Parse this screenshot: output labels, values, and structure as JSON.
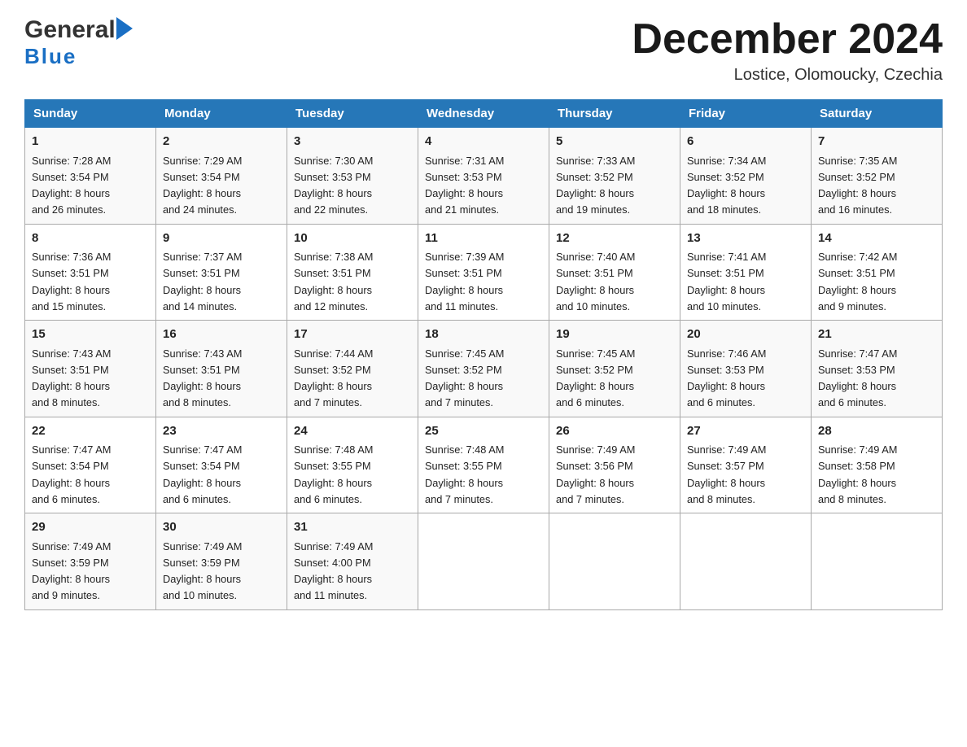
{
  "header": {
    "month_title": "December 2024",
    "location": "Lostice, Olomoucky, Czechia"
  },
  "logo": {
    "general": "General",
    "blue": "Blue"
  },
  "days_of_week": [
    "Sunday",
    "Monday",
    "Tuesday",
    "Wednesday",
    "Thursday",
    "Friday",
    "Saturday"
  ],
  "weeks": [
    [
      {
        "day": "1",
        "sunrise": "7:28 AM",
        "sunset": "3:54 PM",
        "daylight": "8 hours and 26 minutes."
      },
      {
        "day": "2",
        "sunrise": "7:29 AM",
        "sunset": "3:54 PM",
        "daylight": "8 hours and 24 minutes."
      },
      {
        "day": "3",
        "sunrise": "7:30 AM",
        "sunset": "3:53 PM",
        "daylight": "8 hours and 22 minutes."
      },
      {
        "day": "4",
        "sunrise": "7:31 AM",
        "sunset": "3:53 PM",
        "daylight": "8 hours and 21 minutes."
      },
      {
        "day": "5",
        "sunrise": "7:33 AM",
        "sunset": "3:52 PM",
        "daylight": "8 hours and 19 minutes."
      },
      {
        "day": "6",
        "sunrise": "7:34 AM",
        "sunset": "3:52 PM",
        "daylight": "8 hours and 18 minutes."
      },
      {
        "day": "7",
        "sunrise": "7:35 AM",
        "sunset": "3:52 PM",
        "daylight": "8 hours and 16 minutes."
      }
    ],
    [
      {
        "day": "8",
        "sunrise": "7:36 AM",
        "sunset": "3:51 PM",
        "daylight": "8 hours and 15 minutes."
      },
      {
        "day": "9",
        "sunrise": "7:37 AM",
        "sunset": "3:51 PM",
        "daylight": "8 hours and 14 minutes."
      },
      {
        "day": "10",
        "sunrise": "7:38 AM",
        "sunset": "3:51 PM",
        "daylight": "8 hours and 12 minutes."
      },
      {
        "day": "11",
        "sunrise": "7:39 AM",
        "sunset": "3:51 PM",
        "daylight": "8 hours and 11 minutes."
      },
      {
        "day": "12",
        "sunrise": "7:40 AM",
        "sunset": "3:51 PM",
        "daylight": "8 hours and 10 minutes."
      },
      {
        "day": "13",
        "sunrise": "7:41 AM",
        "sunset": "3:51 PM",
        "daylight": "8 hours and 10 minutes."
      },
      {
        "day": "14",
        "sunrise": "7:42 AM",
        "sunset": "3:51 PM",
        "daylight": "8 hours and 9 minutes."
      }
    ],
    [
      {
        "day": "15",
        "sunrise": "7:43 AM",
        "sunset": "3:51 PM",
        "daylight": "8 hours and 8 minutes."
      },
      {
        "day": "16",
        "sunrise": "7:43 AM",
        "sunset": "3:51 PM",
        "daylight": "8 hours and 8 minutes."
      },
      {
        "day": "17",
        "sunrise": "7:44 AM",
        "sunset": "3:52 PM",
        "daylight": "8 hours and 7 minutes."
      },
      {
        "day": "18",
        "sunrise": "7:45 AM",
        "sunset": "3:52 PM",
        "daylight": "8 hours and 7 minutes."
      },
      {
        "day": "19",
        "sunrise": "7:45 AM",
        "sunset": "3:52 PM",
        "daylight": "8 hours and 6 minutes."
      },
      {
        "day": "20",
        "sunrise": "7:46 AM",
        "sunset": "3:53 PM",
        "daylight": "8 hours and 6 minutes."
      },
      {
        "day": "21",
        "sunrise": "7:47 AM",
        "sunset": "3:53 PM",
        "daylight": "8 hours and 6 minutes."
      }
    ],
    [
      {
        "day": "22",
        "sunrise": "7:47 AM",
        "sunset": "3:54 PM",
        "daylight": "8 hours and 6 minutes."
      },
      {
        "day": "23",
        "sunrise": "7:47 AM",
        "sunset": "3:54 PM",
        "daylight": "8 hours and 6 minutes."
      },
      {
        "day": "24",
        "sunrise": "7:48 AM",
        "sunset": "3:55 PM",
        "daylight": "8 hours and 6 minutes."
      },
      {
        "day": "25",
        "sunrise": "7:48 AM",
        "sunset": "3:55 PM",
        "daylight": "8 hours and 7 minutes."
      },
      {
        "day": "26",
        "sunrise": "7:49 AM",
        "sunset": "3:56 PM",
        "daylight": "8 hours and 7 minutes."
      },
      {
        "day": "27",
        "sunrise": "7:49 AM",
        "sunset": "3:57 PM",
        "daylight": "8 hours and 8 minutes."
      },
      {
        "day": "28",
        "sunrise": "7:49 AM",
        "sunset": "3:58 PM",
        "daylight": "8 hours and 8 minutes."
      }
    ],
    [
      {
        "day": "29",
        "sunrise": "7:49 AM",
        "sunset": "3:59 PM",
        "daylight": "8 hours and 9 minutes."
      },
      {
        "day": "30",
        "sunrise": "7:49 AM",
        "sunset": "3:59 PM",
        "daylight": "8 hours and 10 minutes."
      },
      {
        "day": "31",
        "sunrise": "7:49 AM",
        "sunset": "4:00 PM",
        "daylight": "8 hours and 11 minutes."
      },
      null,
      null,
      null,
      null
    ]
  ],
  "labels": {
    "sunrise": "Sunrise:",
    "sunset": "Sunset:",
    "daylight": "Daylight:"
  },
  "colors": {
    "header_bg": "#2677b8",
    "header_text": "#ffffff",
    "border": "#aaa"
  }
}
